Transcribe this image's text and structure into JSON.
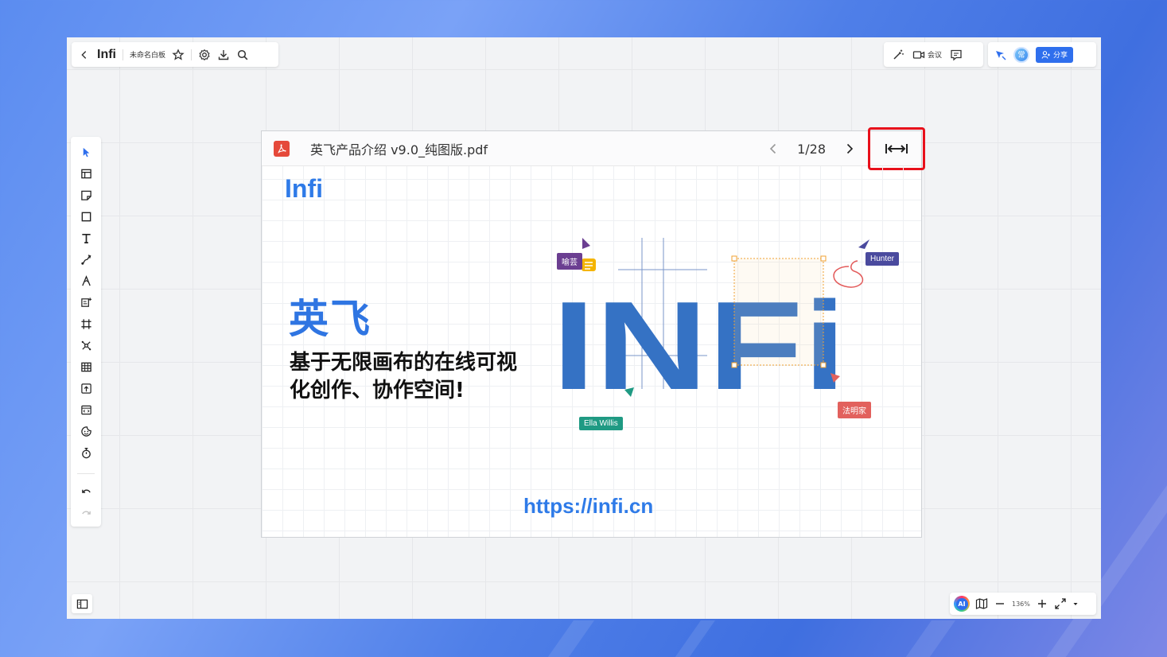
{
  "toolbar": {
    "app_name": "Infi",
    "board_name": "未命名白板",
    "meeting_label": "会议",
    "avatar_initial": "常",
    "share_label": "分享"
  },
  "pdf": {
    "filename": "英飞产品介绍 v9.0_纯图版.pdf",
    "page_indicator": "1/28"
  },
  "slide": {
    "logo": "Infi",
    "brand_cn": "英飞",
    "slogan_line1": "基于无限画布的在线可视",
    "slogan_line2": "化创作、协作空间!",
    "url": "https://infi.cn",
    "artwork_text": "INFi",
    "cursor_tags": [
      {
        "name": "喻芸",
        "color": "#6b3e91"
      },
      {
        "name": "Hunter",
        "color": "#4a4a9e"
      },
      {
        "name": "Ella Willis",
        "color": "#1f9a83"
      },
      {
        "name": "法明家",
        "color": "#e2615d"
      }
    ]
  },
  "zoom": {
    "ai_label": "AI",
    "level": "136%"
  },
  "colors": {
    "accent": "#2f6fed",
    "highlight_border": "#e8101b",
    "brand_blue": "#2f7be8"
  }
}
